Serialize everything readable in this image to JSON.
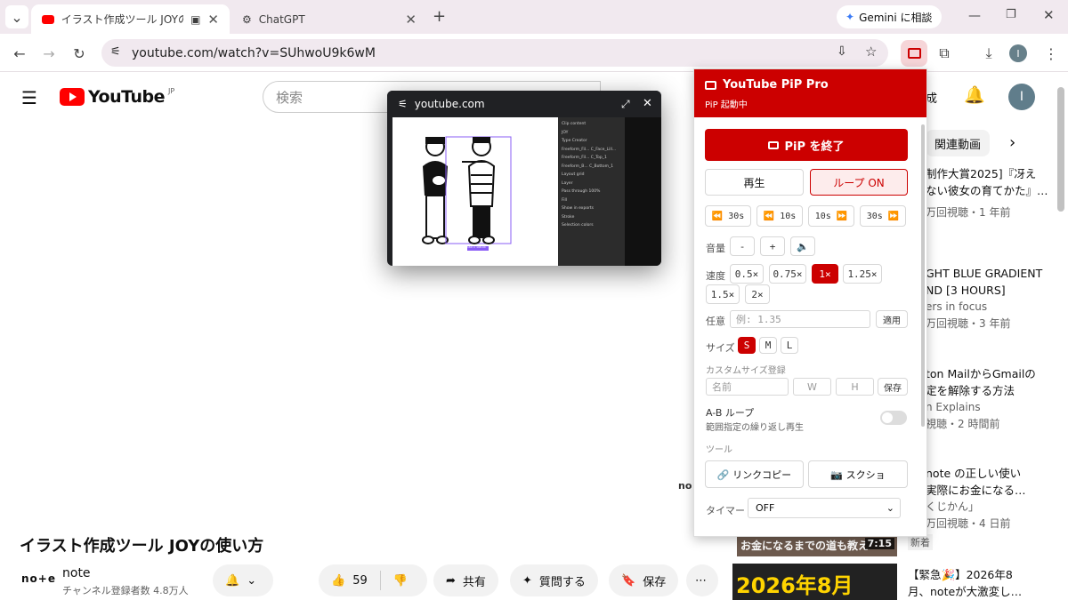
{
  "browser": {
    "tabs": [
      {
        "title": "イラスト作成ツール JOYの使い方"
      },
      {
        "title": "ChatGPT"
      }
    ],
    "new_tab": "+",
    "gemini_label": "Gemini に相談",
    "url": "youtube.com/watch?v=SUhwoU9k6wM",
    "profile_initial": "I"
  },
  "youtube": {
    "logo_text": "YouTube",
    "region": "JP",
    "search_placeholder": "検索",
    "partial_create": "成",
    "profile_initial": "I",
    "chips_label": "関連動画",
    "video_title": "イラスト作成ツール JOYの使い方",
    "channel_name": "note",
    "channel_logo": "no+e",
    "subscribers": "チャンネル登録者数 4.8万人",
    "center_fragment": "no",
    "likes": "59",
    "share": "共有",
    "ask": "質問する",
    "save": "保存",
    "related": [
      {
        "line1": "制作大賞2025]『冴え",
        "line2": "ない彼女の育てかた』…",
        "meta": "万回視聴・1 年前"
      },
      {
        "line1": "GHT BLUE GRADIENT",
        "line2": "ND [3 HOURS]",
        "meta2": "ers in focus",
        "meta": "万回視聴・3 年前"
      },
      {
        "line1": "ton MailからGmailの",
        "line2": "定を解除する方法",
        "meta2": "n Explains",
        "meta": "視聴・2 時間前"
      },
      {
        "line1": "note の正しい使い",
        "line2": "実際にお金になる…",
        "meta2": "くじかん」",
        "meta": "万回視聴・4 日前"
      }
    ],
    "thumb1_caption": "お金になるまでの道も教え",
    "thumb1_duration": "7:15",
    "new_badge": "新着",
    "thumb2_caption": "2026年8月",
    "related5_line1": "【緊急🎉】2026年8",
    "related5_line2": "月、noteが大激変し…"
  },
  "pip": {
    "domain": "youtube.com",
    "layers_panel": {
      "clip_content": "Clip content",
      "joy": "JOY",
      "type_col": "Type",
      "creator_col": "Creator",
      "rows": [
        {
          "name": "Freeform_Fil...",
          "type": "C_Face_Lill..."
        },
        {
          "name": "Freeform_Fil...",
          "type": "C_Top_1"
        },
        {
          "name": "Freeform_B...",
          "type": "C_Bottom_1"
        }
      ],
      "layout_grid": "Layout grid",
      "layer": "Layer",
      "pass_through": "Pass through",
      "percent": "100%",
      "fill": "Fill",
      "show_in_exports": "Show in exports",
      "stroke": "Stroke",
      "selection_colors": "Selection colors"
    },
    "size_tag": "160 × 198.04"
  },
  "extension": {
    "title": "YouTube PiP Pro",
    "status": "PiP 起動中",
    "end_button": "PiP を終了",
    "play": "再生",
    "loop": "ループ ON",
    "seek": [
      "⏪ 30s",
      "⏪ 10s",
      "10s ⏩",
      "30s ⏩"
    ],
    "volume_label": "音量",
    "volume_minus": "-",
    "volume_plus": "+",
    "volume_icon": "🔈",
    "speed_label": "速度",
    "speeds": [
      "0.5×",
      "0.75×",
      "1×",
      "1.25×",
      "1.5×",
      "2×"
    ],
    "speed_selected": "1×",
    "custom_label": "任意",
    "custom_placeholder": "例: 1.35",
    "apply": "適用",
    "size_label": "サイズ",
    "sizes": [
      "S",
      "M",
      "L"
    ],
    "size_selected": "S",
    "custom_size_label": "カスタムサイズ登録",
    "name_placeholder": "名前",
    "w_placeholder": "W",
    "h_placeholder": "H",
    "save": "保存",
    "ab_title": "A-B ループ",
    "ab_sub": "範囲指定の繰り返し再生",
    "ab_enabled": false,
    "tools_label": "ツール",
    "copy_link": "🔗 リンクコピー",
    "screenshot": "📷 スクショ",
    "timer_label": "タイマー",
    "timer_value": "OFF"
  },
  "colors": {
    "accent": "#cc0000",
    "youtube_red": "#ff0000",
    "tab_bg": "#f1e9ef"
  }
}
